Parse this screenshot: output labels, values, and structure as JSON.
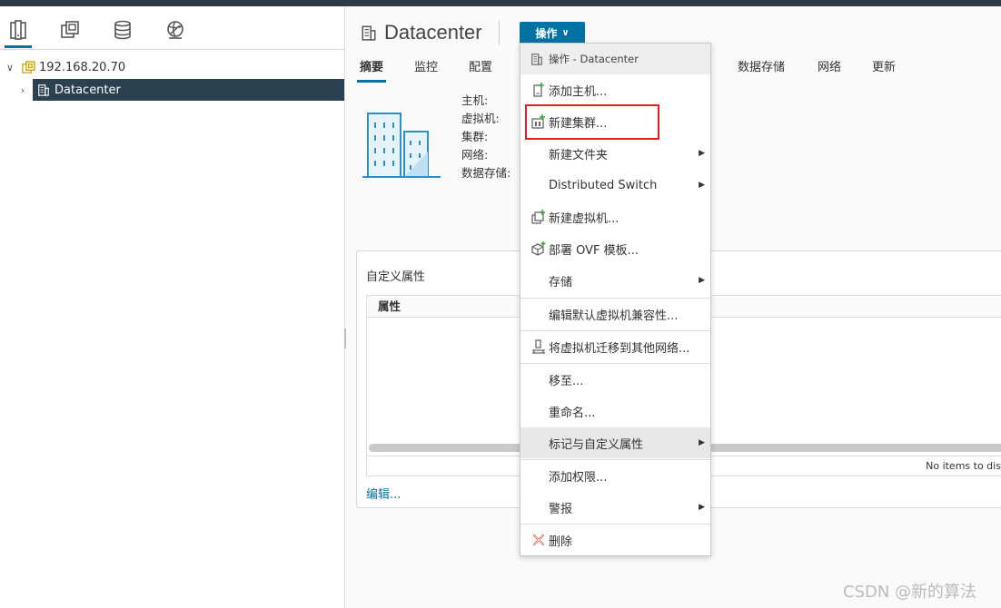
{
  "nav": {
    "tabs": [
      {
        "icon": "hosts-clusters-icon"
      },
      {
        "icon": "vms-templates-icon"
      },
      {
        "icon": "storage-icon"
      },
      {
        "icon": "networking-icon"
      }
    ],
    "tree": {
      "root": "192.168.20.70",
      "datacenter": "Datacenter"
    }
  },
  "header": {
    "title": "Datacenter",
    "actions_label": "操作"
  },
  "tabs": [
    "摘要",
    "监控",
    "配置",
    "数据存储",
    "网络",
    "更新"
  ],
  "summary": {
    "labels": [
      "主机:",
      "虚拟机:",
      "集群:",
      "网络:",
      "数据存储:"
    ]
  },
  "custom_attributes": {
    "title": "自定义属性",
    "column": "属性",
    "empty": "No items to displ",
    "edit": "编辑..."
  },
  "menu": {
    "header": "操作 - Datacenter",
    "items": [
      {
        "label": "添加主机...",
        "icon": "add-host-icon"
      },
      {
        "label": "新建集群...",
        "icon": "new-cluster-icon"
      },
      {
        "label": "新建文件夹",
        "submenu": true
      },
      {
        "label": "Distributed Switch",
        "submenu": true
      },
      {
        "label": "新建虚拟机...",
        "icon": "new-vm-icon"
      },
      {
        "label": "部署 OVF 模板...",
        "icon": "deploy-ovf-icon"
      },
      {
        "label": "存储",
        "submenu": true
      },
      {
        "label": "编辑默认虚拟机兼容性..."
      },
      {
        "label": "将虚拟机迁移到其他网络...",
        "icon": "migrate-network-icon"
      },
      {
        "label": "移至..."
      },
      {
        "label": "重命名..."
      },
      {
        "label": "标记与自定义属性",
        "submenu": true
      },
      {
        "label": "添加权限..."
      },
      {
        "label": "警报",
        "submenu": true
      },
      {
        "label": "删除",
        "icon": "delete-icon"
      }
    ]
  },
  "watermark": "CSDN @新的算法",
  "colors": {
    "accent": "#0072a3",
    "highlight": "#e02020",
    "tree_selected": "#2b4150"
  }
}
